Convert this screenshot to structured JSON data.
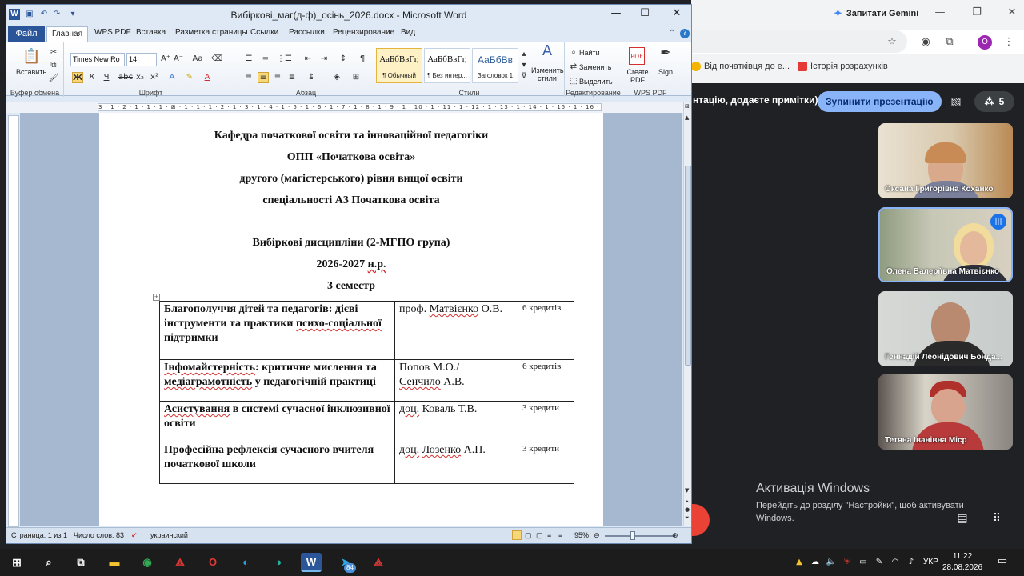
{
  "browser": {
    "gemini_label": "Запитати Gemini",
    "profile_letter": "О",
    "bookmarks": [
      "Від початківця до е...",
      "Історія розрахунків"
    ]
  },
  "meet": {
    "presenting_text": "нтацію, додаєте примітки)",
    "stop_button": "Зупинити презентацію",
    "people_count": "5",
    "participants": [
      {
        "name": "Оксана Григорівна Коханко"
      },
      {
        "name": "Олена Валеріївна Матвієнко"
      },
      {
        "name": "Геннадій Леонідович Бонда..."
      },
      {
        "name": "Тетяна Іванівна Міср"
      }
    ]
  },
  "activation": {
    "title": "Активація Windows",
    "text": "Перейдіть до розділу \"Настройки\", щоб активувати Windows."
  },
  "word": {
    "title": "Вибіркові_маг(д-ф)_осінь_2026.docx - Microsoft Word",
    "tabs": {
      "file": "Файл",
      "home": "Главная",
      "others": [
        "WPS PDF",
        "Вставка",
        "Разметка страницы",
        "Ссылки",
        "Рассылки",
        "Рецензирование",
        "Вид"
      ]
    },
    "ribbon": {
      "paste": "Вставить",
      "font_name": "Times New Ro",
      "font_size": "14",
      "styles": [
        {
          "preview": "АаБбВвГг,",
          "name": "¶ Обычный"
        },
        {
          "preview": "АаБбВвГг,",
          "name": "¶ Без интер..."
        },
        {
          "preview": "АаБбВв",
          "name": "Заголовок 1"
        }
      ],
      "change_styles": "Изменить стили",
      "find": "Найти",
      "replace": "Заменить",
      "select": "Выделить",
      "create_pdf": "Create PDF",
      "sign": "Sign",
      "groups": [
        "Буфер обмена",
        "Шрифт",
        "Абзац",
        "Стили",
        "Редактирование",
        "WPS PDF"
      ]
    },
    "ruler_text": "3 · 1 · 2 · 1 · 1 · 1 · ⊠ · 1 · 1 · 1 · 2 · 1 · 3 · 1 · 4 · 1 · 5 · 1 · 6 · 1 · 7 · 1 · 8 · 1 · 9 · 1 · 10 · 1 · 11 · 1 · 12 · 1 · 13 · 1 · 14 · 1 · 15 · 1 · 16 · ⊠ · 17 ·",
    "document": {
      "lines": [
        "Кафедра початкової освіти та інноваційної педагогіки",
        "ОПП «Початкова освіта»",
        "другого (магістерського) рівня вищої освіти",
        "спеціальності А3 Початкова освіта",
        "Вибіркові дисципліни (2-МГПО група)",
        "2026-2027",
        "н.р.",
        "3 семестр"
      ],
      "rows": [
        {
          "course_a": "Благополуччя дітей та педагогів: дієві інструменти та практики ",
          "course_sq": "психо-соціальної",
          "course_b": " підтримки",
          "teacher_a": "проф. ",
          "teacher_sq": "Матвієнко",
          "teacher_b": " О.В.",
          "credits": "6 кредитів"
        },
        {
          "course_sq": "Інфомайстерність",
          "course_a": ": критичне мислення та ",
          "course_sq2": "медіаграмотність",
          "course_b": " у педагогічній практиці",
          "teacher_a": "Попов М.О./",
          "teacher_sq": "Сенчило",
          "teacher_b": " А.В.",
          "credits": "6 кредитів"
        },
        {
          "course_sq": "Асистування",
          "course_b": " в системі сучасної інклюзивної освіти",
          "teacher_sq": "доц.",
          "teacher_b": " Коваль Т.В.",
          "credits": "3 кредити"
        },
        {
          "course_b": "Професійна рефлексія сучасного вчителя початкової школи",
          "teacher_sq": "доц.",
          "teacher_b": " ",
          "teacher_sq2": "Лозенко",
          "teacher_c": " А.П.",
          "credits": "3 кредити"
        }
      ]
    },
    "status": {
      "page": "Страница: 1 из 1",
      "words": "Число слов: 83",
      "language": "украинский",
      "zoom": "95%"
    }
  },
  "taskbar": {
    "word_badge": "W",
    "telegram_badge": "84",
    "lang": "УКР",
    "time": "11:22",
    "date": "28.08.2026"
  }
}
